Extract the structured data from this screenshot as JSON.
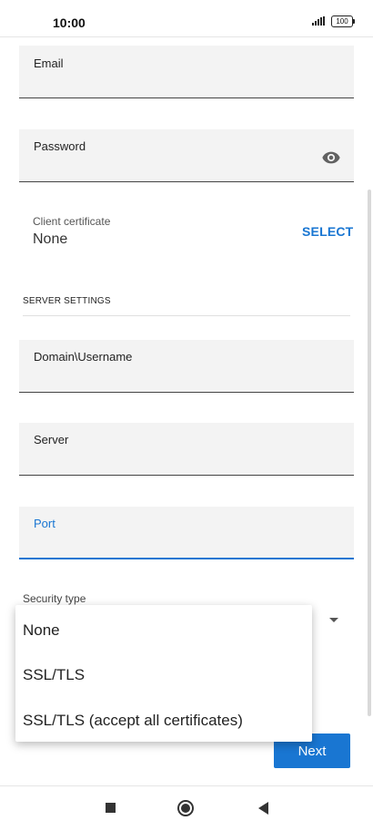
{
  "status_bar": {
    "time": "10:00",
    "battery": "100",
    "signal_icon": "signal-bars-icon",
    "battery_icon": "battery-icon"
  },
  "form": {
    "email_label": "Email",
    "password_label": "Password",
    "password_toggle_icon": "eye-icon",
    "client_certificate": {
      "label": "Client certificate",
      "value": "None",
      "action": "SELECT"
    },
    "server_settings_title": "SERVER SETTINGS",
    "domain_username_label": "Domain\\Username",
    "server_label": "Server",
    "port_label": "Port",
    "security_type_label": "Security type",
    "next_button": "Next"
  },
  "security_menu": {
    "options": [
      "None",
      "SSL/TLS",
      "SSL/TLS (accept all certificates)"
    ]
  },
  "nav_bar": {
    "recents_icon": "square-icon",
    "home_icon": "circle-icon",
    "back_icon": "back-triangle-icon"
  },
  "colors": {
    "accent": "#1976d2",
    "field_bg": "#f3f3f3"
  }
}
